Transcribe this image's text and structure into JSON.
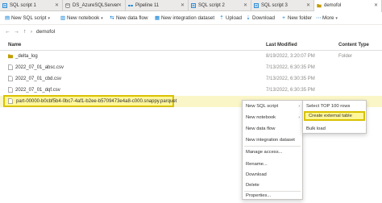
{
  "tabs": [
    {
      "label": "SQL script 1",
      "icon": "sql-script-icon"
    },
    {
      "label": "DS_AzureSQLServer",
      "icon": "dataset-icon"
    },
    {
      "label": "Pipeline 11",
      "icon": "pipeline-icon"
    },
    {
      "label": "SQL script 2",
      "icon": "sql-script-icon"
    },
    {
      "label": "SQL script 3",
      "icon": "sql-script-icon"
    },
    {
      "label": "demofol",
      "icon": "folder-icon"
    }
  ],
  "toolbar": {
    "new_sql_script": "New SQL script",
    "new_notebook": "New notebook",
    "new_data_flow": "New data flow",
    "new_integration_dataset": "New integration dataset",
    "upload": "Upload",
    "download": "Download",
    "new_folder": "New folder",
    "more": "More"
  },
  "path": "demofol",
  "columns": {
    "name": "Name",
    "last_modified": "Last Modified",
    "content_type": "Content Type"
  },
  "rows": [
    {
      "name": "_delta_log",
      "modified": "8/19/2022, 3:20:07 PM",
      "type": "Folder"
    },
    {
      "name": "2022_07_01_absc.csv",
      "modified": "7/13/2022, 6:30:35 PM",
      "type": ""
    },
    {
      "name": "2022_07_01_cbd.csv",
      "modified": "7/13/2022, 6:30:35 PM",
      "type": ""
    },
    {
      "name": "2022_07_01_dqf.csv",
      "modified": "7/13/2022, 6:30:35 PM",
      "type": ""
    },
    {
      "name": "part-00000-b0cbf5b4-0bc7-4af1-b2ee-b5709473e4a8-c000.snappy.parquet",
      "modified": "",
      "type": ""
    }
  ],
  "context_menu": [
    "New SQL script",
    "New notebook",
    "New data flow",
    "New integration dataset",
    "Manage access...",
    "Rename...",
    "Download",
    "Delete",
    "Properties..."
  ],
  "submenu": [
    "Select TOP 100 rows",
    "Create external table",
    "Bulk load"
  ],
  "colors": {
    "highlight": "#fff79a",
    "highlight_border": "#d9c100",
    "accent": "#0078d4"
  }
}
